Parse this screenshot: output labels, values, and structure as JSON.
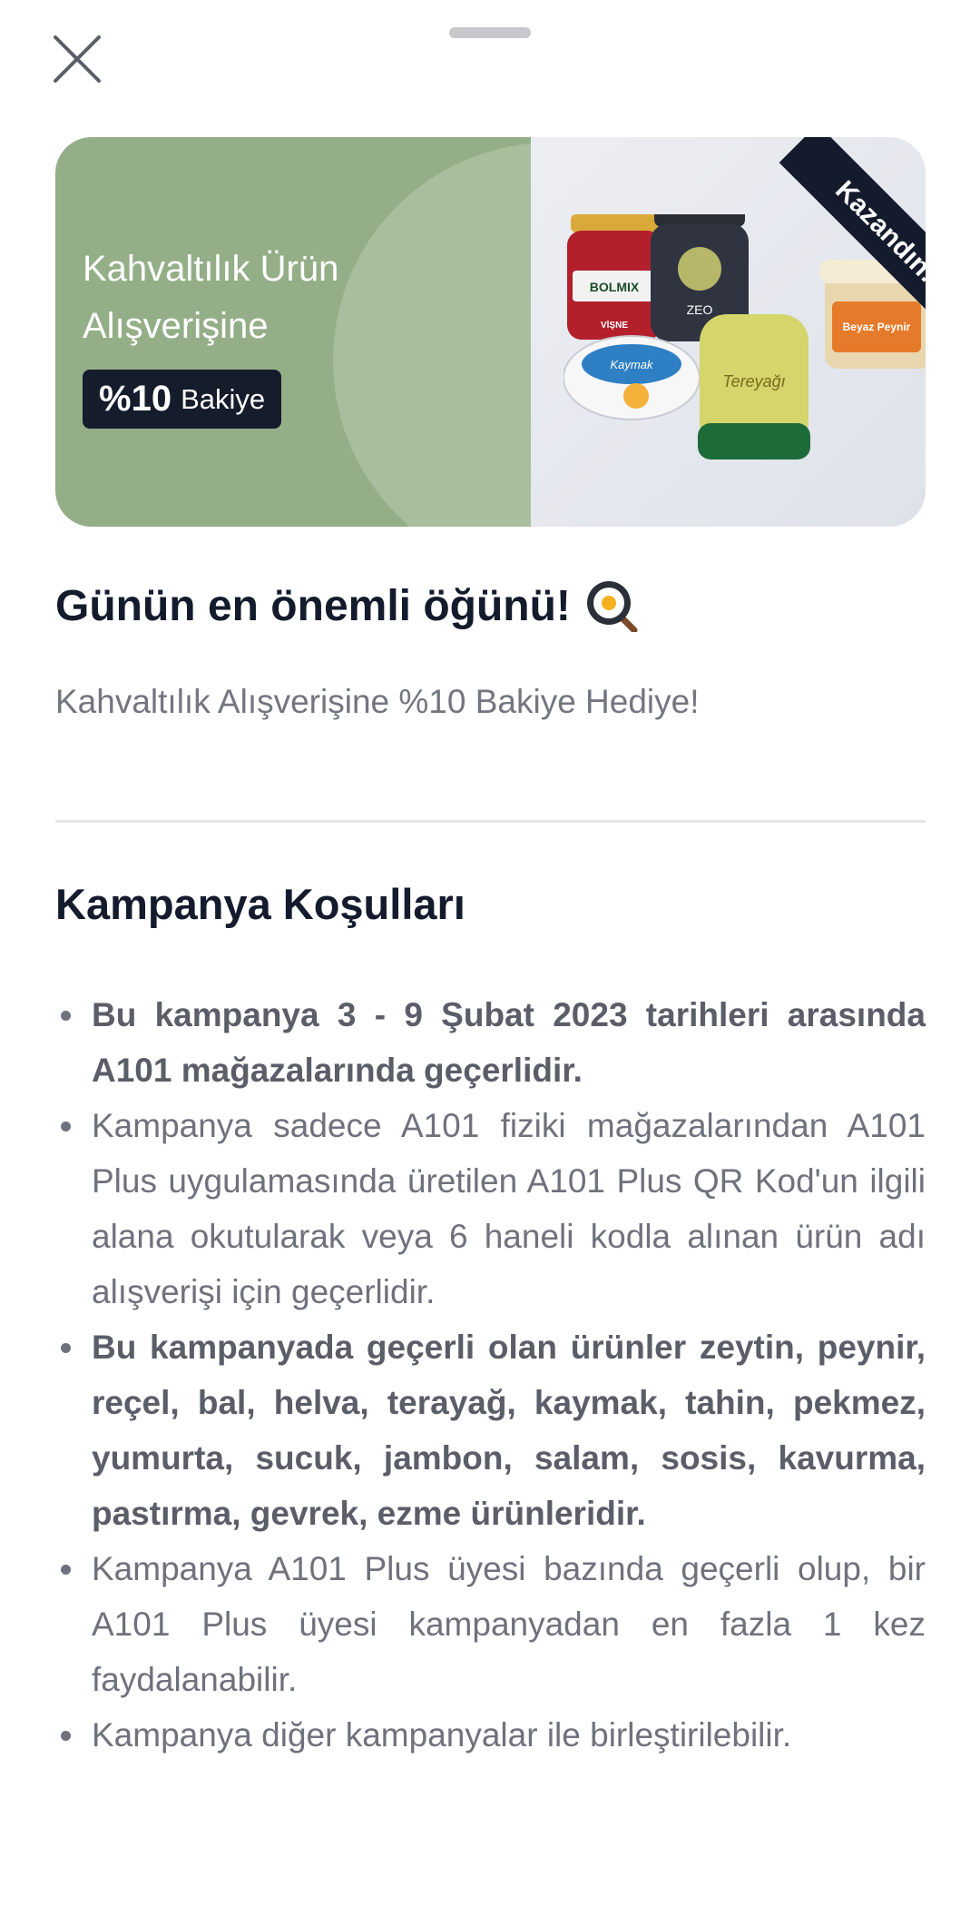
{
  "banner": {
    "title_line1": "Kahvaltılık Ürün",
    "title_line2": "Alışverişine",
    "badge_percent": "%10",
    "badge_word": "Bakiye",
    "ribbon_text": "Kazandın! 🎉",
    "product_labels": {
      "jam": "BOLMIX",
      "jam_sub": "VİŞNE",
      "olives": "ZEO",
      "butter": "Tereyağı",
      "cream": "Kaymak",
      "cheese": "Beyaz Peynir"
    }
  },
  "title": "Günün en önemli öğünü!",
  "title_icon": "frying-pan-egg-icon",
  "subtitle": "Kahvaltılık Alışverişine %10 Bakiye Hediye!",
  "section_title": "Kampanya Koşulları",
  "terms": [
    {
      "text": "Bu kampanya 3 - 9 Şubat 2023 tarihleri arasında A101 mağazalarında geçerlidir.",
      "bold": true
    },
    {
      "text": "Kampanya sadece A101 fiziki mağazalarından A101 Plus uygulamasında üretilen A101 Plus QR Kod'un ilgili alana okutularak veya 6 haneli kodla alınan ürün adı alışverişi için geçerlidir.",
      "bold": false
    },
    {
      "text": "Bu kampanyada geçerli olan ürünler zeytin, peynir, reçel, bal, helva, terayağ, kaymak, tahin, pekmez, yumurta, sucuk, jambon, salam, sosis, kavurma, pastırma, gevrek, ezme ürünleridir.",
      "bold": true
    },
    {
      "text": "Kampanya A101 Plus üyesi bazında geçerli olup, bir A101 Plus üyesi kampanyadan en fazla 1 kez faydalanabilir.",
      "bold": false
    },
    {
      "text": "Kampanya diğer kampanyalar ile birleştirilebilir.",
      "bold": false
    }
  ],
  "colors": {
    "banner_green": "#94ae88",
    "dark_navy": "#141b2d",
    "text_gray": "#737680"
  }
}
